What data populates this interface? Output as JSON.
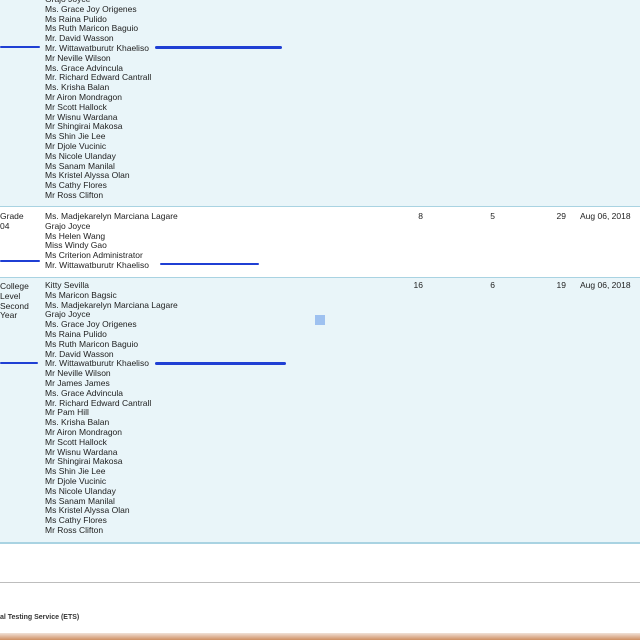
{
  "rows": [
    {
      "names": [
        "Grajo Joyce",
        "Ms. Grace Joy Origenes",
        "Ms Raina Pulido",
        "Ms Ruth Maricon Baguio",
        "Mr. David Wasson",
        "Mr. Wittawatburutr Khaeliso",
        "Mr Neville Wilson",
        "Ms. Grace Advincula",
        "Mr. Richard Edward Cantrall",
        "Ms. Krisha Balan",
        "Mr Airon Mondragon",
        "Mr Scott Hallock",
        "Mr Wisnu Wardana",
        "Mr Shingirai Makosa",
        "Ms Shin Jie Lee",
        "Mr Djole Vucinic",
        "Ms Nicole Ulanday",
        "Ms Sanam Manilal",
        "Ms Kristel Alyssa Olan",
        "Ms Cathy Flores",
        "Mr Ross Clifton"
      ]
    },
    {
      "level": [
        "Grade",
        "04"
      ],
      "names": [
        "Ms. Madjekarelyn Marciana Lagare",
        "Grajo Joyce",
        "Ms Helen Wang",
        "Miss Windy Gao",
        "Ms Criterion Administrator",
        "Mr. Wittawatburutr Khaeliso"
      ],
      "col1": "8",
      "col2": "5",
      "col3": "29",
      "date": "Aug 06, 2018"
    },
    {
      "level": [
        "College",
        "Level",
        "Second",
        "Year"
      ],
      "names": [
        "Kitty Sevilla",
        "Ms Maricon Bagsic",
        "Ms. Madjekarelyn Marciana Lagare",
        "Grajo Joyce",
        "Ms. Grace Joy Origenes",
        "Ms Raina Pulido",
        "Ms Ruth Maricon Baguio",
        "Mr. David Wasson",
        "Mr. Wittawatburutr Khaeliso",
        "Mr Neville Wilson",
        "Mr James James",
        "Ms. Grace Advincula",
        "Mr. Richard Edward Cantrall",
        "Mr Pam Hill",
        "Ms. Krisha Balan",
        "Mr Airon Mondragon",
        "Mr Scott Hallock",
        "Mr Wisnu Wardana",
        "Mr Shingirai Makosa",
        "Ms Shin Jie Lee",
        "Mr Djole Vucinic",
        "Ms Nicole Ulanday",
        "Ms Sanam Manilal",
        "Ms Kristel Alyssa Olan",
        "Ms Cathy Flores",
        "Mr Ross Clifton"
      ],
      "col1": "16",
      "col2": "6",
      "col3": "19",
      "date": "Aug 06, 2018"
    }
  ],
  "footer": {
    "text": "al Testing Service (ETS)"
  },
  "colors": {
    "row_bg": "#e9f5f9",
    "border": "#a9d3e2",
    "marker": "#1f3fd4"
  }
}
